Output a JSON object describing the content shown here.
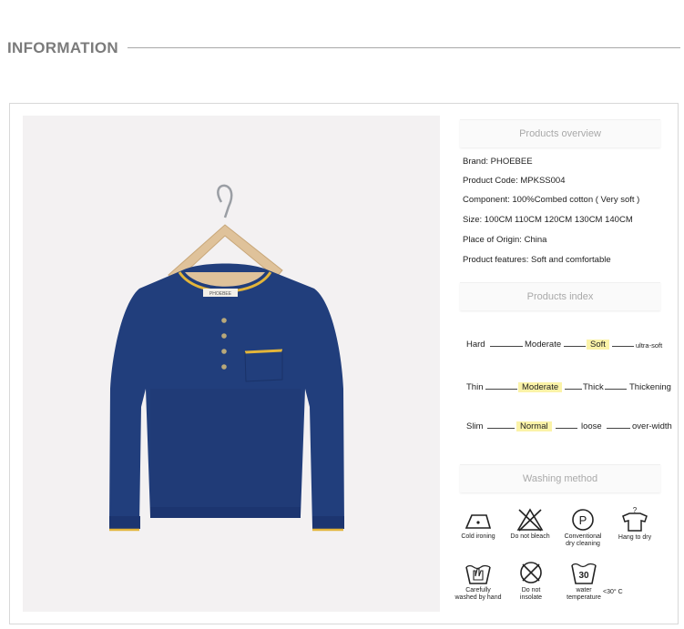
{
  "header": {
    "title": "INFORMATION"
  },
  "photo": {
    "label_text": "PHOEBEE"
  },
  "overview": {
    "title": "Products overview",
    "rows": [
      "Brand:  PHOEBEE",
      "Product Code:  MPKSS004",
      "Component:  100%Combed cotton ( Very soft )",
      "Size:  100CM  110CM  120CM  130CM  140CM",
      "Place of Origin:  China",
      "Product features:  Soft and comfortable"
    ]
  },
  "index": {
    "title": "Products index",
    "softness": [
      "Hard",
      "Moderate",
      "Soft",
      "ultra-soft"
    ],
    "thickness": [
      "Thin",
      "Moderate",
      "Thick",
      "Thickening"
    ],
    "fit": [
      "Slim",
      "Normal",
      "loose",
      "over-width"
    ]
  },
  "washing": {
    "title": "Washing method",
    "icons": [
      {
        "icon": "cold-ironing-icon",
        "label": "Cold ironing"
      },
      {
        "icon": "do-not-bleach-icon",
        "label": "Do not bleach"
      },
      {
        "icon": "dry-cleaning-icon",
        "label_1": "Conventional",
        "label_2": "dry cleaning",
        "symbol": "P"
      },
      {
        "icon": "hang-to-dry-icon",
        "label": "Hang to dry",
        "symbol": "?"
      },
      {
        "icon": "hand-wash-icon",
        "label_1": "Carefully",
        "label_2": "washed by hand"
      },
      {
        "icon": "do-not-insolate-icon",
        "label_1": "Do not",
        "label_2": "insolate"
      },
      {
        "icon": "water-temperature-icon",
        "label_1": "water",
        "label_2": "temperature",
        "symbol": "30",
        "note": "<30° C"
      }
    ]
  }
}
